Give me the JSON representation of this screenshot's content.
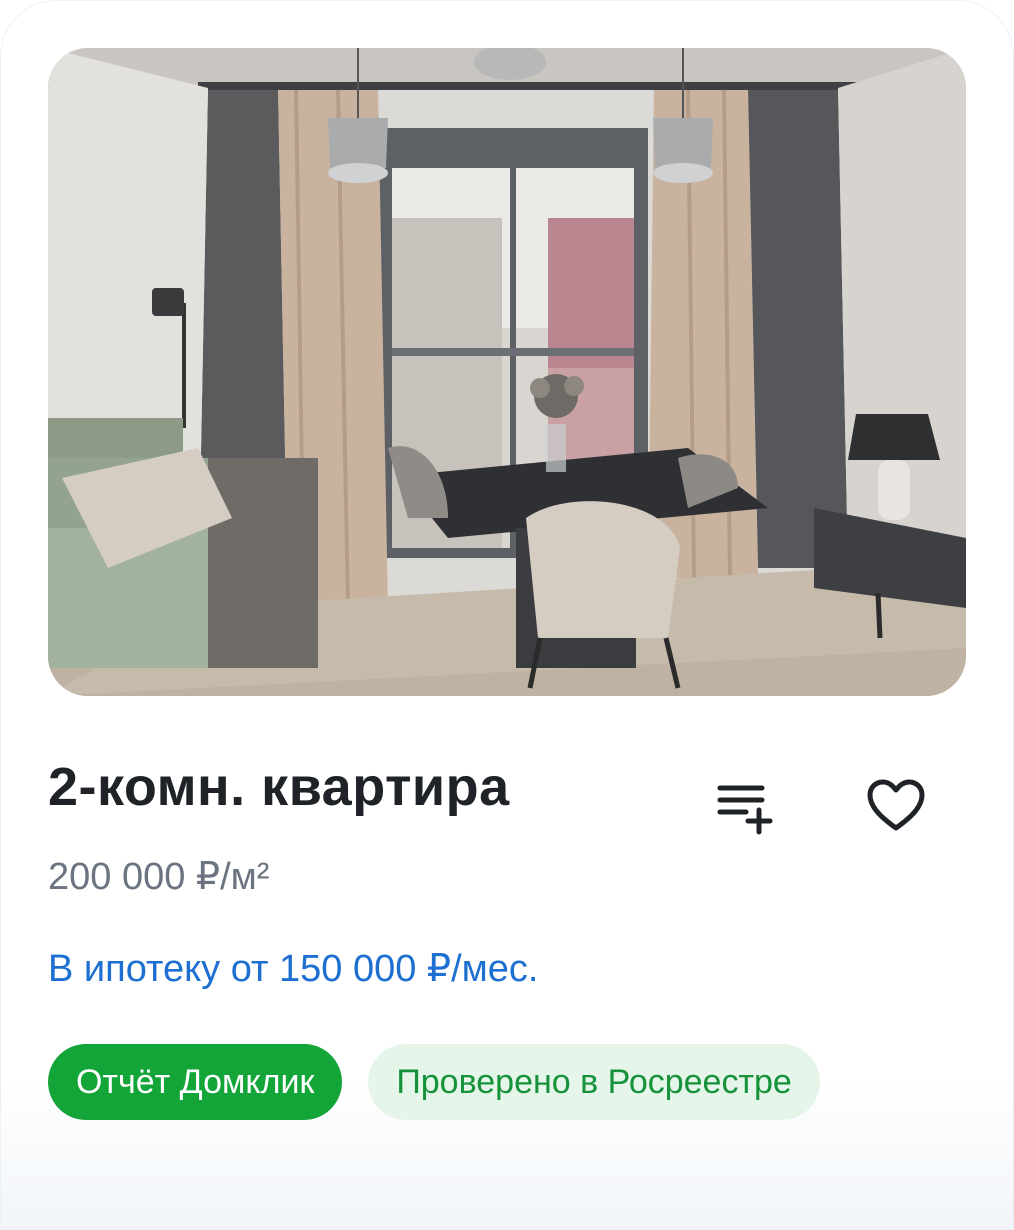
{
  "listing": {
    "title": "2-комн. квартира",
    "price_per_m2": "200 000 ₽/м²",
    "mortgage": "В ипотеку от 150 000 ₽/мес."
  },
  "actions": {
    "compare_icon": "add-to-list-icon",
    "favorite_icon": "heart-icon"
  },
  "badges": [
    {
      "label": "Отчёт Домклик"
    },
    {
      "label": "Проверено в Росреестре"
    }
  ],
  "colors": {
    "primary_green": "#13a538",
    "secondary_green_bg": "#e5f5e9",
    "secondary_green_text": "#16923a",
    "link_blue": "#1d6fd1",
    "title": "#1f2328",
    "muted": "#6b7480"
  }
}
